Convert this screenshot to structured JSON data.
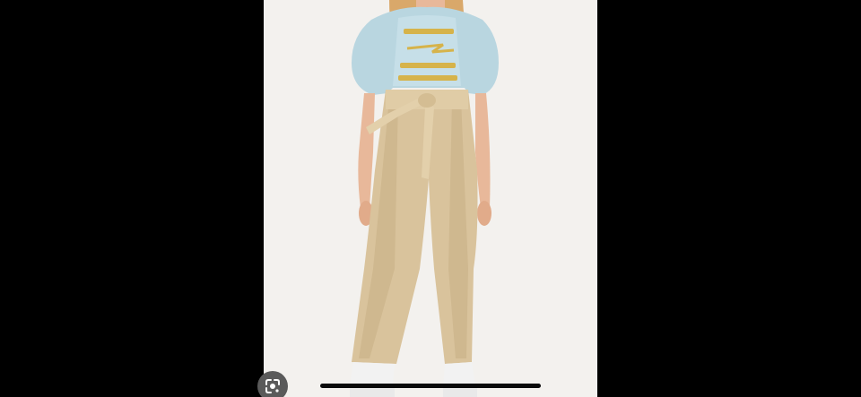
{
  "viewer": {
    "letterbox_color": "#000000",
    "photo_background": "#f3f1ee",
    "photo_alt": "",
    "lens_button": {
      "icon": "google-lens-icon"
    },
    "home_indicator": {
      "color": "#0a0a0a"
    }
  },
  "colors": {
    "sweatshirt": "#b9d6e0",
    "pants": "#d9c39c",
    "hair": "#d9a86a",
    "skin": "#e8b89a",
    "graphic_gold": "#d6b34a"
  }
}
